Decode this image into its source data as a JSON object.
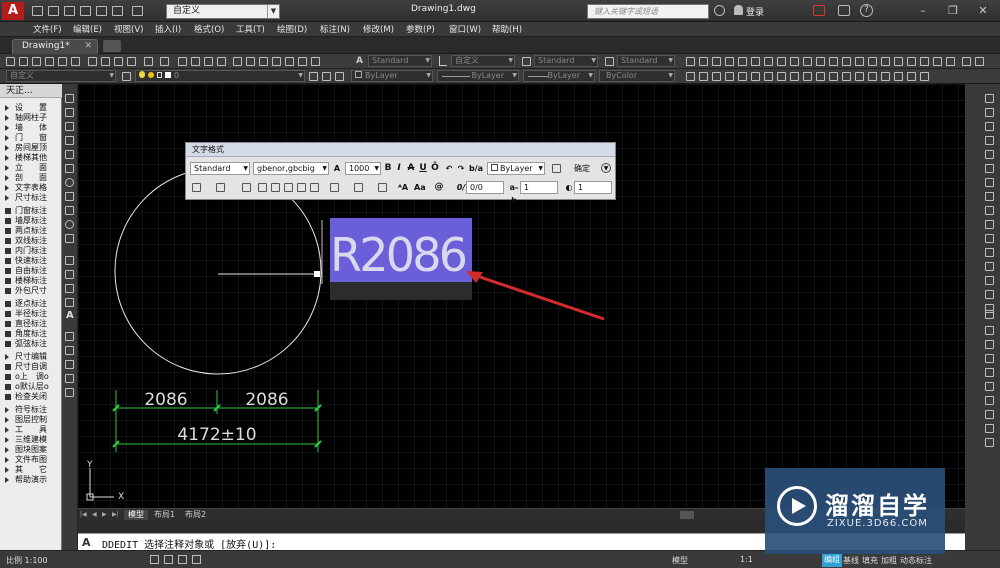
{
  "app": {
    "logo": "A",
    "doc_title": "Drawing1.dwg",
    "workspace": "自定义",
    "search_placeholder": "键入关键字或短语",
    "login": "登录"
  },
  "menu": [
    "文件(F)",
    "编辑(E)",
    "视图(V)",
    "插入(I)",
    "格式(O)",
    "工具(T)",
    "绘图(D)",
    "标注(N)",
    "修改(M)",
    "参数(P)",
    "窗口(W)",
    "帮助(H)"
  ],
  "tabs": {
    "drawing": "Drawing1*"
  },
  "toolbar": {
    "text_style": "Standard",
    "dim_style": "Standard",
    "table_style": "Standard",
    "multileader_style": "Standard",
    "custom": "自定义",
    "layer": "0",
    "color": "ByLayer",
    "linetype": "ByLayer",
    "lineweight": "ByLayer",
    "plotstyle": "ByColor"
  },
  "left_panel": {
    "title": "天正...",
    "items": [
      "设　　置",
      "轴网柱子",
      "墙　　体",
      "门　　窗",
      "房间屋顶",
      "楼梯其他",
      "立　　面",
      "剖　　面",
      "文字表格",
      "尺寸标注",
      "门窗标注",
      "墙厚标注",
      "两点标注",
      "双线标注",
      "内门标注",
      "快速标注",
      "自由标注",
      "楼梯标注",
      "外包尺寸",
      "逐点标注",
      "半径标注",
      "直径标注",
      "角度标注",
      "弧弦标注",
      "尺寸编辑",
      "尺寸自调",
      "o上　调o",
      "o默认层o",
      "检查关闭",
      "符号标注",
      "图层控制",
      "工　　具",
      "三维建模",
      "图块图案",
      "文件布图",
      "其　　它",
      "帮助演示"
    ]
  },
  "text_format": {
    "title": "文字格式",
    "style": "Standard",
    "font": "gbenor,gbcbig",
    "height": "1000",
    "bold": "B",
    "italic": "I",
    "strike": "A",
    "underline": "U",
    "overline": "Ō",
    "color": "ByLayer",
    "ok": "确定",
    "oblique": "0/0",
    "tracking": "1",
    "width": "1",
    "angle": "0"
  },
  "drawing": {
    "edit_text": "R2086",
    "dim_left": "2086",
    "dim_right": "2086",
    "dim_total": "4172±10",
    "ucs_y": "Y",
    "ucs_x": "X",
    "edit_highlight_color": "#6a5fd8",
    "arrow_color": "#d22b2b"
  },
  "layout_tabs": [
    "模型",
    "布局1",
    "布局2"
  ],
  "command": {
    "prompt": "DDEDIT 选择注释对象或 [放弃(U)]:"
  },
  "status": {
    "scale": "比例 1:100",
    "right_items": [
      "模型",
      "1:1",
      "编组",
      "基线",
      "填充",
      "加粗",
      "动态标注"
    ]
  },
  "watermark": {
    "cn": "溜溜自学",
    "url": "ZIXUE.3D66.COM"
  }
}
